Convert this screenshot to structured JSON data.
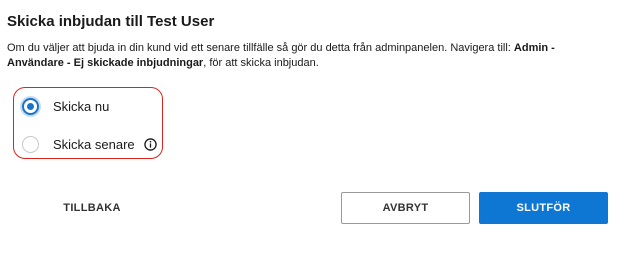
{
  "dialog": {
    "title": "Skicka inbjudan till Test User",
    "description_plain": "Om du väljer att bjuda in din kund vid ett senare tillfälle så gör du detta från adminpanelen. Navigera till: ",
    "description_bold": "Admin - Användare - Ej skickade inbjudningar",
    "description_tail": ", för att skicka inbjudan."
  },
  "options": [
    {
      "label": "Skicka nu",
      "selected": true
    },
    {
      "label": "Skicka senare",
      "selected": false,
      "icon": "info-icon"
    }
  ],
  "buttons": {
    "back": "TILLBAKA",
    "cancel": "AVBRYT",
    "finish": "SLUTFÖR"
  },
  "colors": {
    "accent": "#0e77d3",
    "highlight_border": "#d9251c",
    "radio_selected": "#1a73c9"
  }
}
